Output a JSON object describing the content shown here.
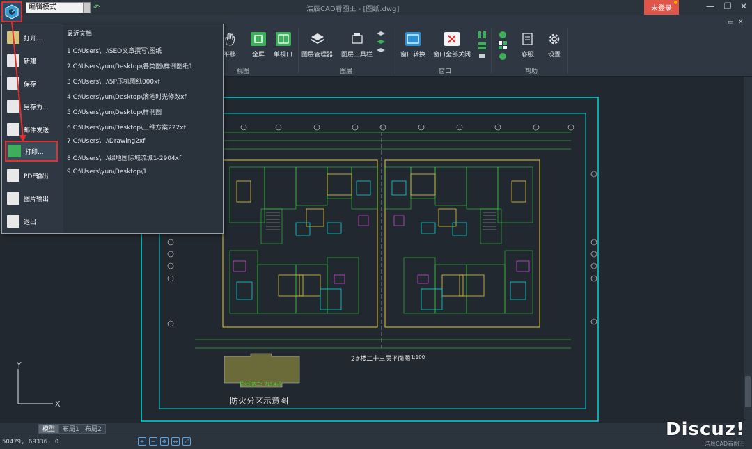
{
  "window": {
    "title": "浩辰CAD看图王 - [图纸.dwg]",
    "mode": "编辑模式",
    "login_label": "未登录",
    "minimize": "—",
    "maximize": "❐",
    "close": "✕"
  },
  "ribbon": {
    "buttons": [
      {
        "label": "平移"
      },
      {
        "label": "全屏"
      },
      {
        "label": "单视口"
      },
      {
        "label": "图层管理器"
      },
      {
        "label": "图层工具栏"
      },
      {
        "label": "窗口转换"
      },
      {
        "label": "窗口全部关闭"
      },
      {
        "label": "客服"
      },
      {
        "label": "设置"
      }
    ],
    "groups": [
      "视图",
      "图层",
      "窗口",
      "帮助"
    ]
  },
  "menu": {
    "items": [
      {
        "label": "打开...",
        "icon": "folder-open-icon"
      },
      {
        "label": "新建",
        "icon": "new-file-icon"
      },
      {
        "label": "保存",
        "icon": "save-icon"
      },
      {
        "label": "另存为...",
        "icon": "save-as-icon"
      },
      {
        "label": "邮件发送",
        "icon": "mail-icon"
      },
      {
        "label": "打印...",
        "icon": "printer-icon"
      },
      {
        "label": "PDF输出",
        "icon": "pdf-icon"
      },
      {
        "label": "图片输出",
        "icon": "image-export-icon"
      },
      {
        "label": "退出",
        "icon": "exit-icon"
      }
    ],
    "recent_title": "最近文档",
    "recent": [
      "1 C:\\Users\\...\\SEO文章撰写\\图纸",
      "2 C:\\Users\\yun\\Desktop\\各类图\\样例图纸1",
      "3 C:\\Users\\...\\5P压机图纸000xf",
      "4 C:\\Users\\yun\\Desktop\\滴池时光修改xf",
      "5 C:\\Users\\yun\\Desktop\\样例图",
      "6 C:\\Users\\yun\\Desktop\\三维方案222xf",
      "7 C:\\Users\\...\\Drawing2xf",
      "8 C:\\Users\\...\\绿地国际城流城1-2904xf",
      "9 C:\\Users\\yun\\Desktop\\1"
    ]
  },
  "drawing": {
    "plan_title": "2#楼二十三层平面图",
    "plan_scale": "1:100",
    "fire_title": "防火分区示意图",
    "fire_label": "防火分区二：715.4㎡",
    "axis_y": "Y",
    "axis_x": "X"
  },
  "tabs": [
    "模型",
    "布局1",
    "布局2"
  ],
  "status": {
    "coords": "50479, 69336, 0",
    "brand": "浩辰CAD看图王"
  },
  "watermark": "Discuz!",
  "colors": {
    "accent_red": "#e03030",
    "login_red": "#e0554a",
    "cad_frame": "#00d8d8",
    "cad_line_green": "#38e838",
    "cad_line_yellow": "#e8c830"
  }
}
